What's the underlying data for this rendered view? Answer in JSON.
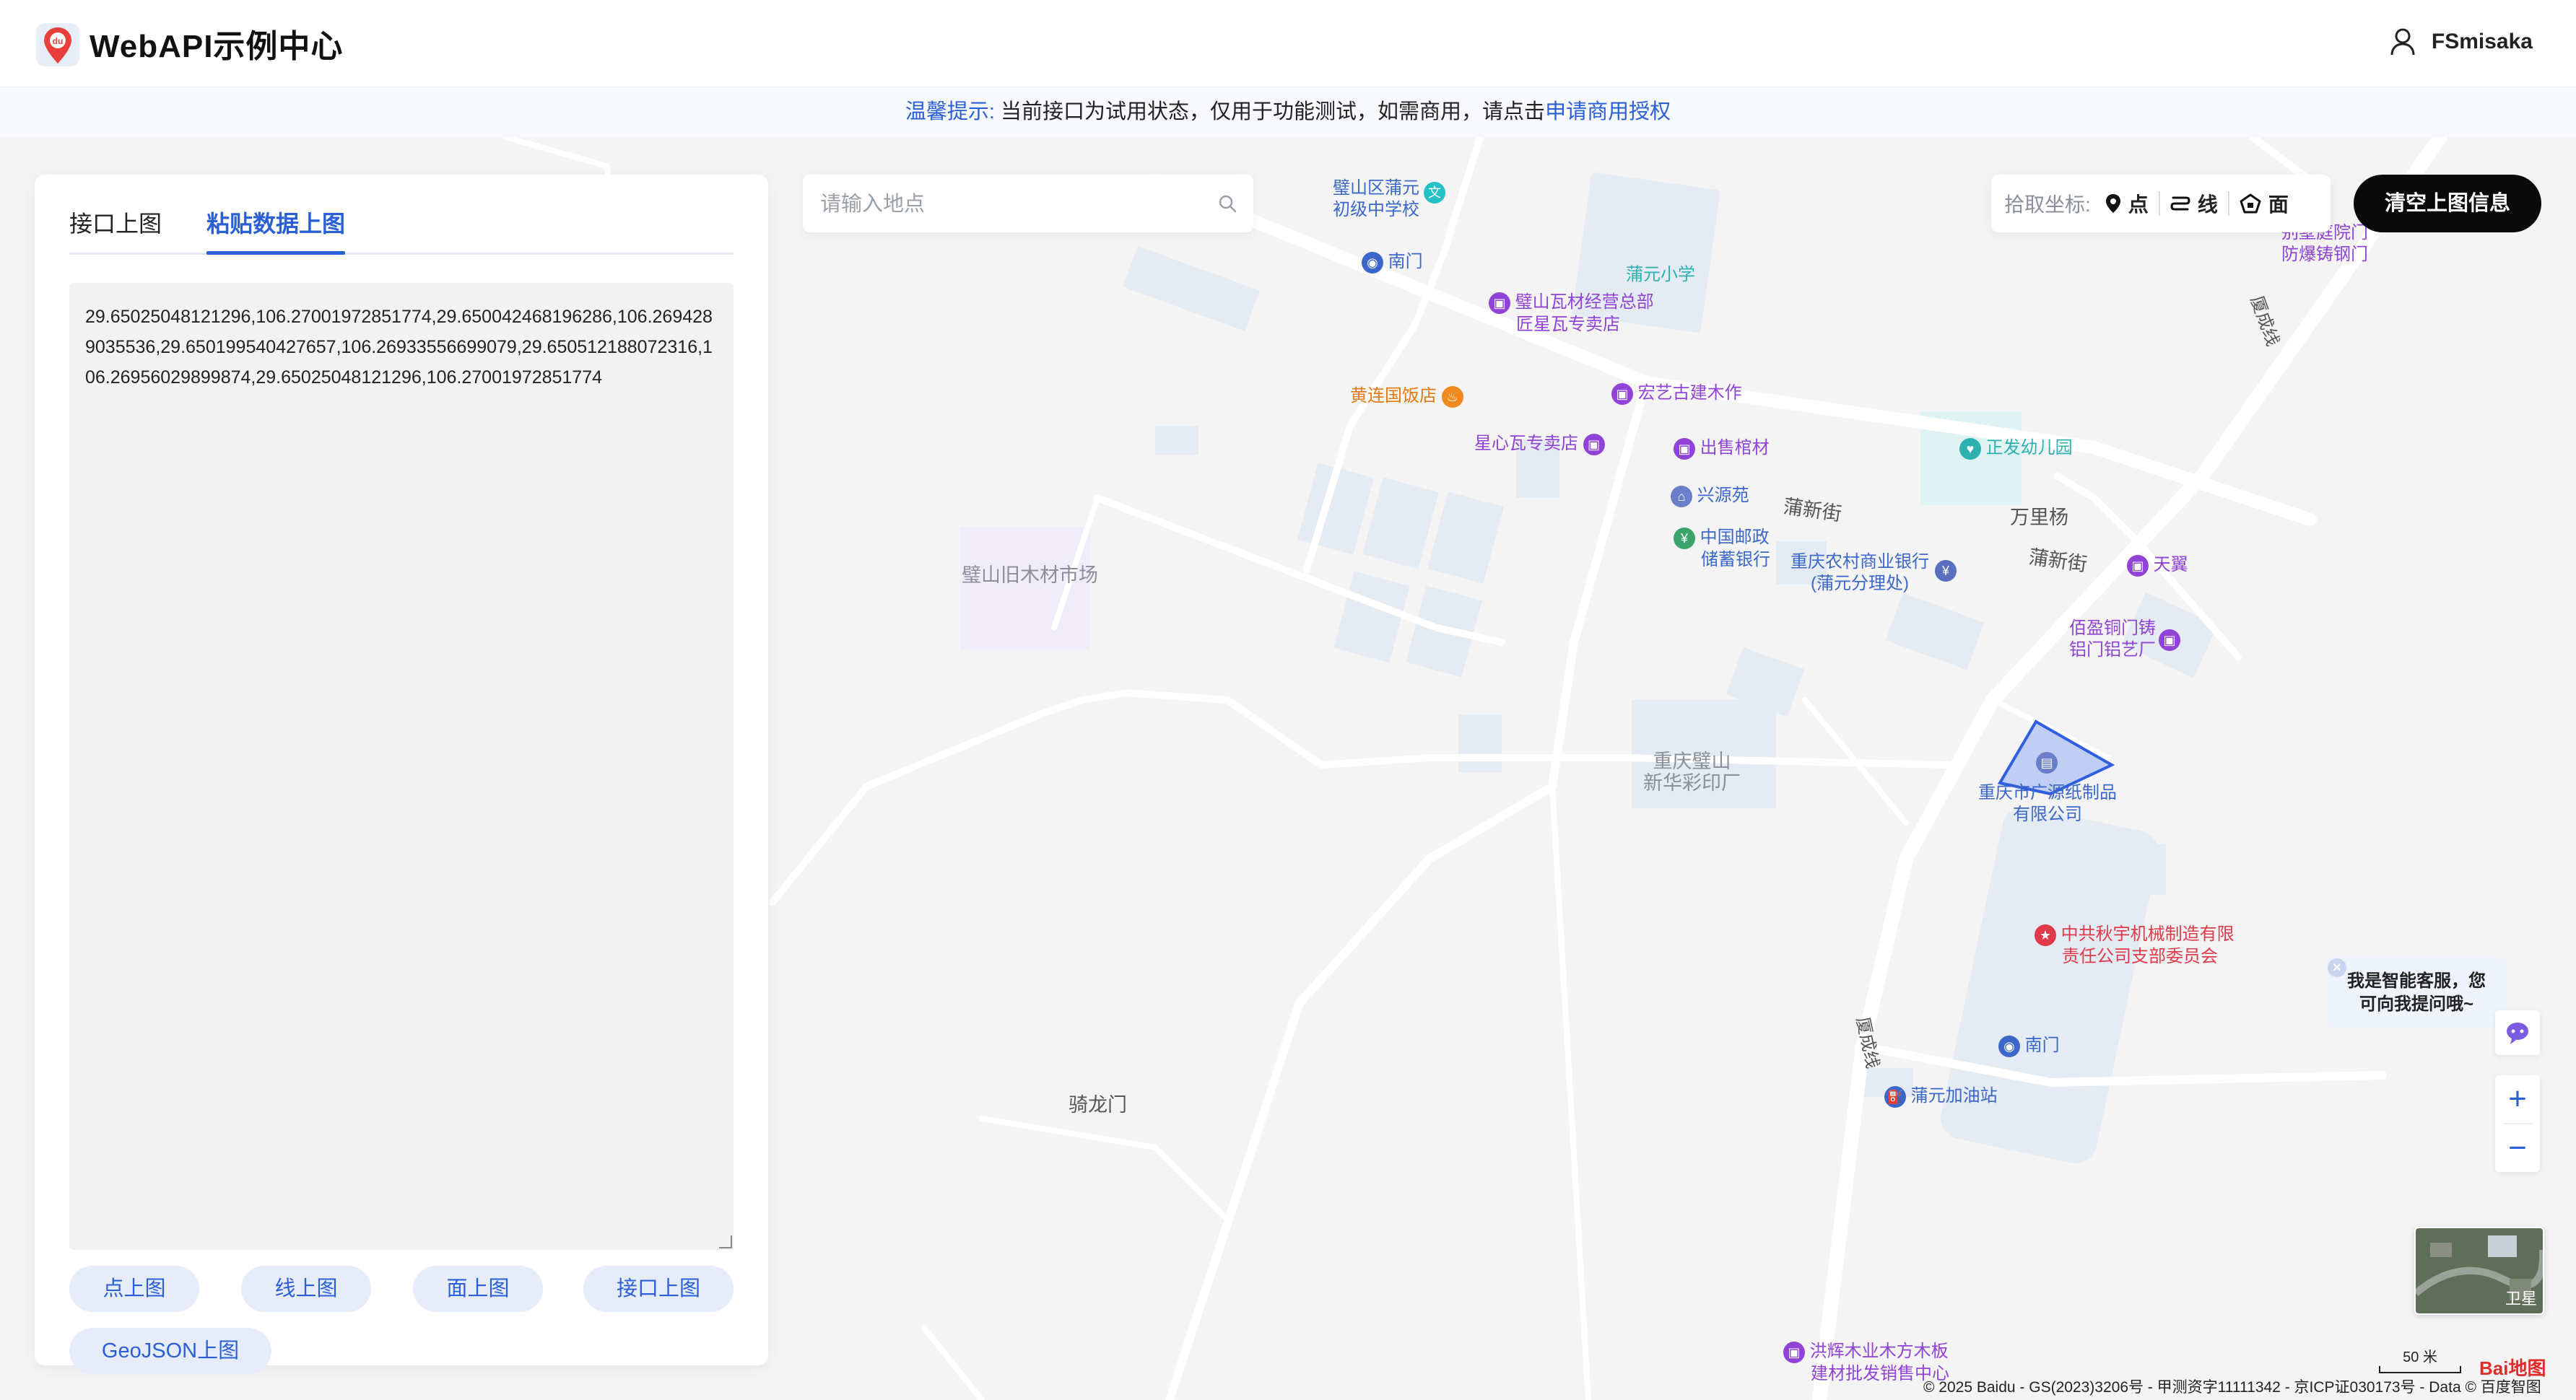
{
  "header": {
    "app_title": "WebAPI示例中心",
    "username": "FSmisaka"
  },
  "notice": {
    "label": "温馨提示:",
    "message": "当前接口为试用状态，仅用于功能测试，如需商用，请点击",
    "link": "申请商用授权"
  },
  "panel": {
    "tabs": [
      "接口上图",
      "粘贴数据上图"
    ],
    "active_tab": "粘贴数据上图",
    "data_text": "29.65025048121296,106.27001972851774,29.650042468196286,106.2694289035536,29.650199540427657,106.26933556699079,29.650512188072316,106.26956029899874,29.65025048121296,106.27001972851774",
    "buttons": {
      "point": "点上图",
      "line": "线上图",
      "polygon": "面上图",
      "api": "接口上图",
      "geojson": "GeoJSON上图"
    }
  },
  "search": {
    "placeholder": "请输入地点"
  },
  "picker": {
    "label": "拾取坐标:",
    "point": "点",
    "line": "线",
    "polygon": "面"
  },
  "clear_button": "清空上图信息",
  "assistant": {
    "line1": "我是智能客服，您",
    "line2": "可向我提问哦~"
  },
  "map": {
    "labels": {
      "school_1": "璧山区蒲元",
      "school_2": "初级中学校",
      "south_gate_1": "南门",
      "puyuan_primary": "蒲元小学",
      "tile_1": "璧山瓦材经营总部",
      "tile_2": "匠星瓦专卖店",
      "villa_1": "别墅庭院门",
      "villa_2": "防爆铸钢门",
      "huanglian": "黄连国饭店",
      "hongyi": "宏艺古建木作",
      "xingxin": "星心瓦专卖店",
      "coffin": "出售棺材",
      "zhengfa": "正发幼儿园",
      "xingyuan": "兴源苑",
      "puxin_1": "蒲新街",
      "puxin_2": "蒲新街",
      "wanliyang": "万里杨",
      "post_1": "中国邮政",
      "post_2": "储蓄银行",
      "bank_1": "重庆农村商业银行",
      "bank_2": "(蒲元分理处)",
      "tianyi": "天翼",
      "old_wood": "璧山旧木材市场",
      "baiying_1": "佰盈铜门铸",
      "baiying_2": "铝门铝艺厂",
      "xinhua_1": "重庆璧山",
      "xinhua_2": "新华彩印厂",
      "guangyuan_1": "重庆市广源纸制品",
      "guangyuan_2": "有限公司",
      "qiuyu_1": "中共秋宇机械制造有限",
      "qiuyu_2": "责任公司支部委员会",
      "south_gate_2": "南门",
      "gas": "蒲元加油站",
      "qilongmen": "骑龙门",
      "hongjin_1": "洪辉木业木方木板",
      "hongjin_2": "建材批发销售中心",
      "xiacheng_1": "厦成线",
      "xiacheng_2": "厦成线"
    },
    "scale": "50 米",
    "satellite_label": "卫星",
    "copyright": "© 2025 Baidu - GS(2023)3206号 - 甲测资字11111342 - 京ICP证030173号 - Data © 百度智图",
    "baidu_logo": "Bai地图",
    "polygon_coords": [
      [
        29.65025048121296,
        106.27001972851774
      ],
      [
        29.650042468196286,
        106.2694289035536
      ],
      [
        29.650199540427657,
        106.26933556699079
      ],
      [
        29.650512188072316,
        106.26956029899874
      ],
      [
        29.65025048121296,
        106.27001972851774
      ]
    ]
  },
  "colors": {
    "accent": "#2a5fd6",
    "poi_purple": "#9043d6",
    "poi_blue": "#3a67c9",
    "poi_teal": "#2cb0b0",
    "poi_orange": "#e07a12",
    "poi_red": "#e03a4a",
    "polygon_fill": "#a9bdf2",
    "polygon_stroke": "#2f5fe0"
  }
}
